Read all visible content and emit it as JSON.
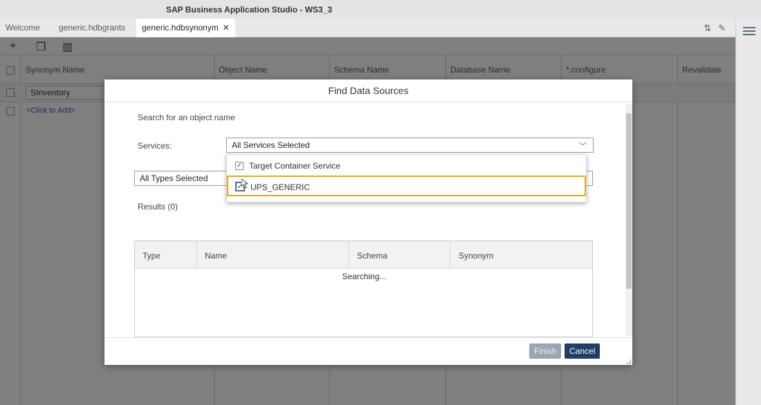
{
  "window": {
    "title": "SAP Business Application Studio - WS3_3"
  },
  "tabs": [
    {
      "label": "Welcome",
      "active": false
    },
    {
      "label": "generic.hdbgrants",
      "active": false
    },
    {
      "label": "generic.hdbsynonym",
      "active": true,
      "close": "✕"
    }
  ],
  "grid": {
    "columns": [
      "Synonym Name",
      "Object Name",
      "Schema Name",
      "Database Name",
      "*.configure",
      "Revalidate"
    ],
    "row1": {
      "synonym": "SInventory"
    },
    "add_link": "<Click to Add>"
  },
  "dialog": {
    "title": "Find Data Sources",
    "search_label": "Search for an object name",
    "services_label": "Services:",
    "services_value": "All Services Selected",
    "types_value": "All Types Selected",
    "results_label": "Results (0)",
    "dropdown_items": [
      {
        "label": "Target Container Service",
        "checked": true
      },
      {
        "label": "UPS_GENERIC",
        "checked": true
      }
    ],
    "table_columns": [
      "Type",
      "Name",
      "Schema",
      "Synonym"
    ],
    "status": "Searching...",
    "finish_label": "Finish",
    "cancel_label": "Cancel"
  },
  "colors": {
    "accent_highlight": "#e6a817",
    "primary_button": "#1f3f66",
    "disabled_button": "#9aa6b3"
  }
}
